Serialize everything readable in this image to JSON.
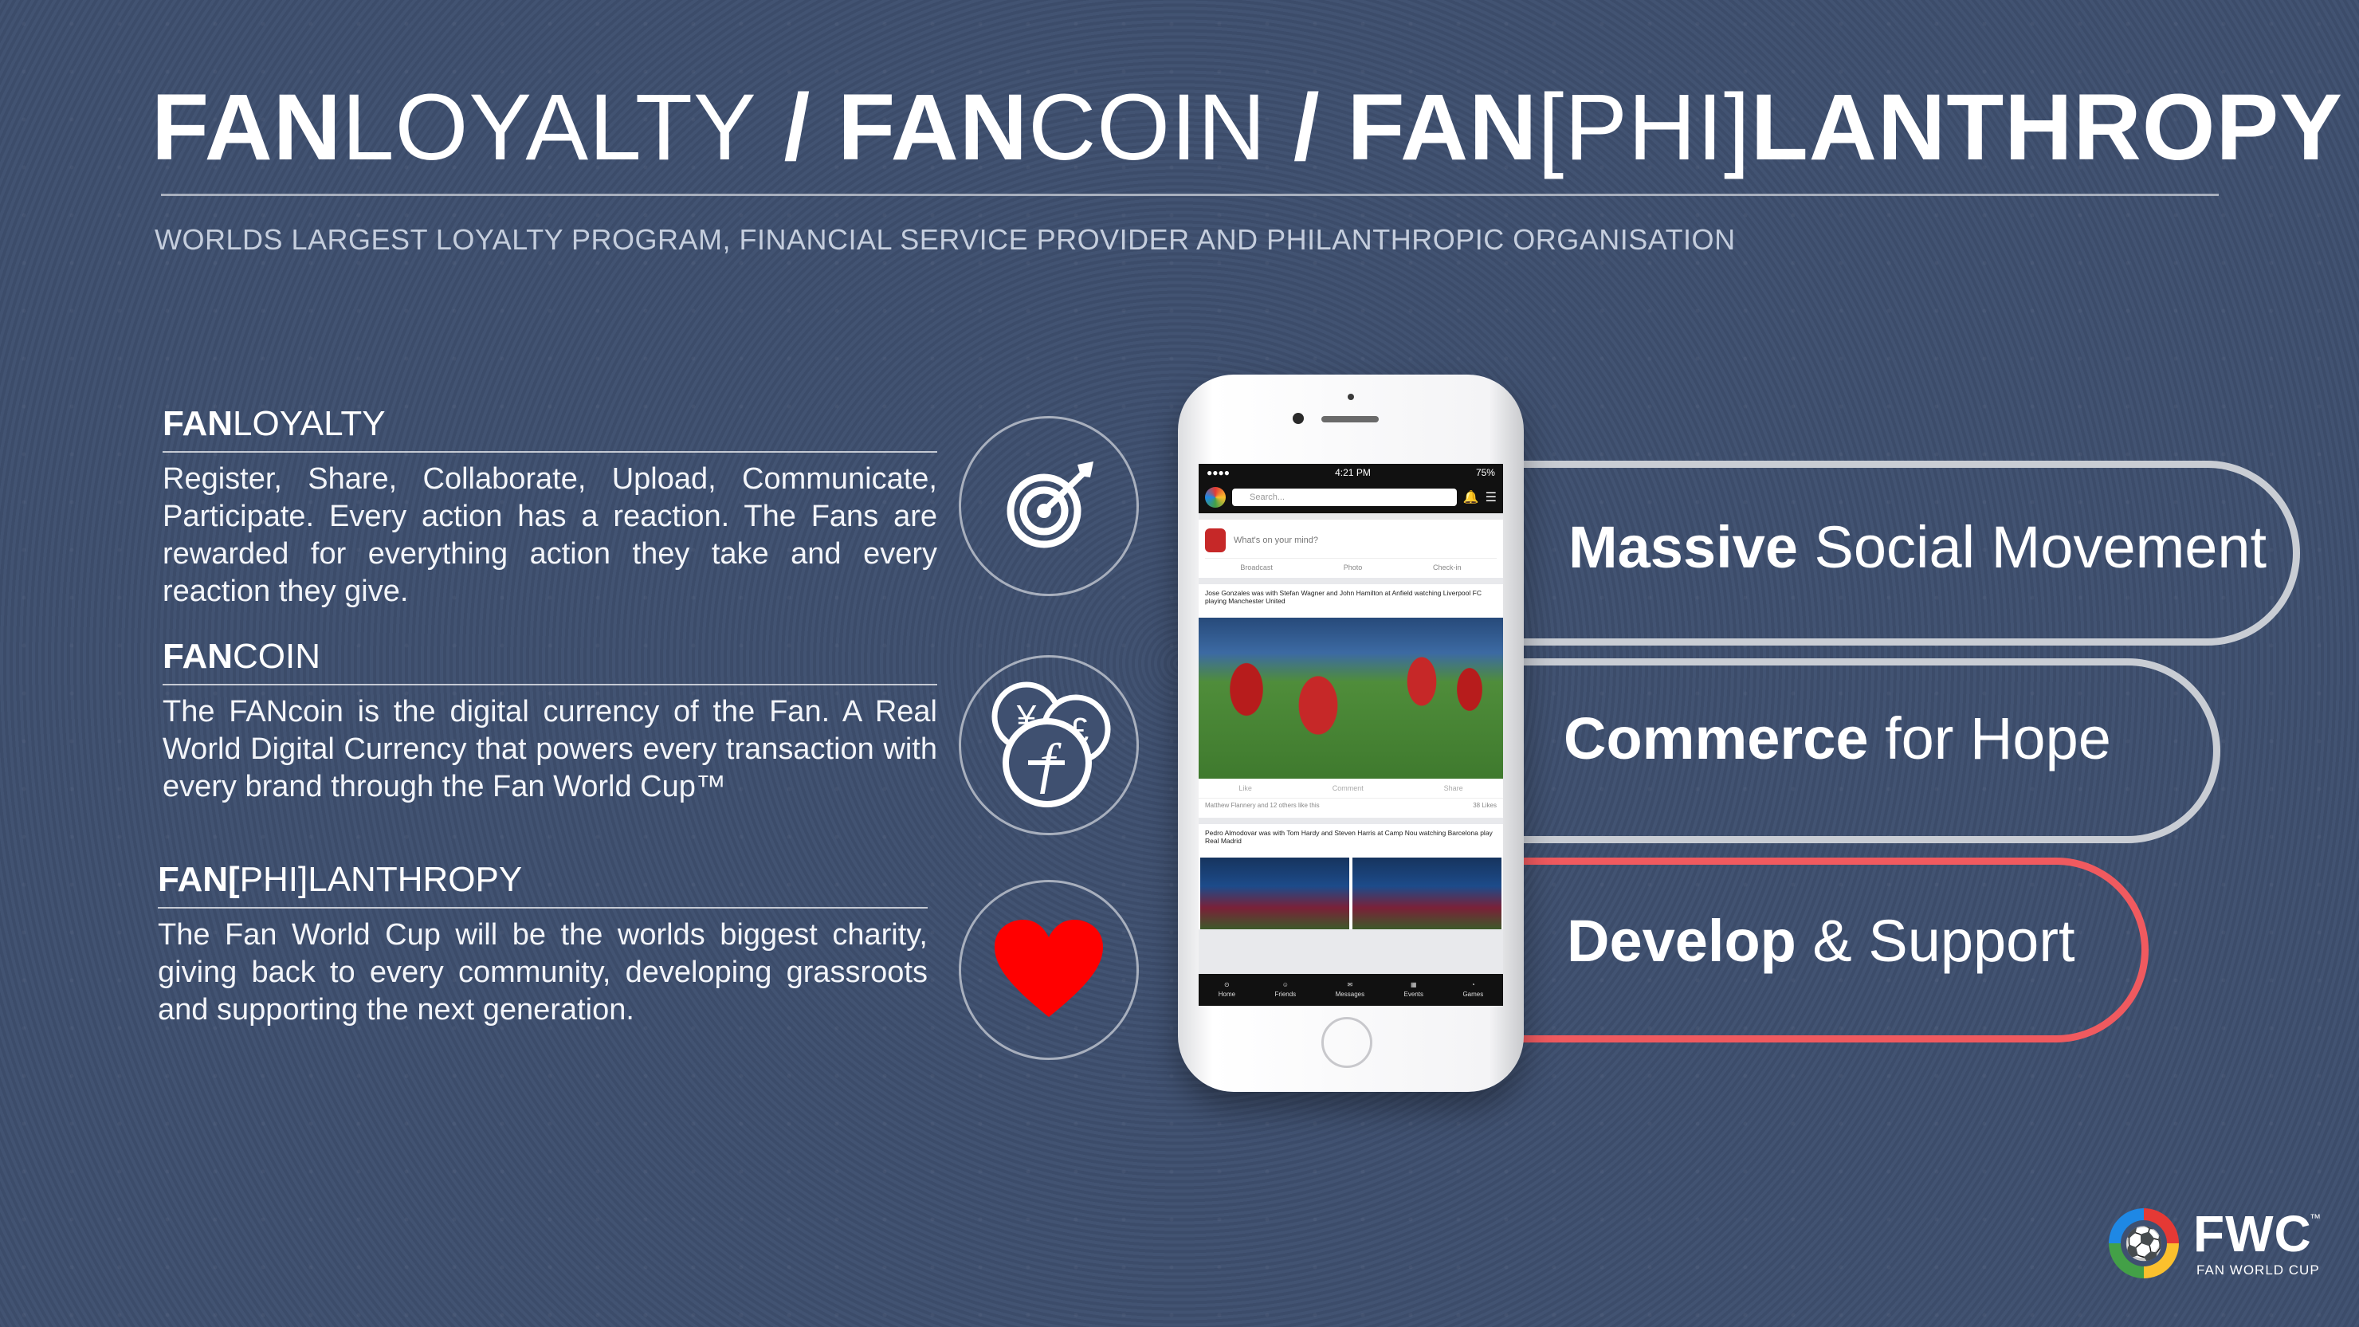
{
  "header": {
    "title_parts": [
      {
        "bold": "FAN",
        "light": "LOYALTY"
      },
      {
        "sep": " / "
      },
      {
        "bold": "FAN",
        "light": "COIN"
      },
      {
        "sep": " / "
      },
      {
        "bold": "FAN",
        "light": "[PHI]",
        "bold2": "LANTHROPY"
      }
    ],
    "subtitle": "WORLDS LARGEST LOYALTY PROGRAM, FINANCIAL SERVICE PROVIDER AND PHILANTHROPIC ORGANISATION"
  },
  "sections": [
    {
      "head_bold": "FAN",
      "head_light": "LOYALTY",
      "body": "Register, Share, Collaborate, Upload, Communicate, Participate. Every action has a reaction. The Fans are rewarded for everything action they take and every reaction they give.",
      "icon": "target-icon"
    },
    {
      "head_bold": "FAN",
      "head_light": "COIN",
      "body": "The FANcoin is the digital currency of the Fan. A Real World Digital Currency that powers every transaction with every brand through the Fan World Cup™",
      "icon": "coins-icon"
    },
    {
      "head_bold": "FAN[",
      "head_light": "PHI]LANTHROPY",
      "body": "The Fan World Cup will be the worlds biggest charity, giving back to every community, developing grassroots and supporting the next generation.",
      "icon": "heart-icon"
    }
  ],
  "pillars": [
    {
      "bold": "Massive",
      "light": " Social Movement",
      "color": "#c9cdd4"
    },
    {
      "bold": "Commerce",
      "light": " for Hope",
      "color": "#c9cdd4"
    },
    {
      "bold": "Develop",
      "light": " & Support",
      "color": "#f05a5f"
    }
  ],
  "phone": {
    "status_left": "●●●●",
    "status_time": "4:21 PM",
    "status_battery": "75%",
    "search_placeholder": "Search...",
    "compose_placeholder": "What's on your mind?",
    "compose_actions": [
      "Broadcast",
      "Photo",
      "Check-in"
    ],
    "post1_meta": "Jose Gonzales was with Stefan Wagner and John Hamilton at Anfield watching Liverpool FC playing Manchester United",
    "post_actions": [
      "Like",
      "Comment",
      "Share"
    ],
    "post1_likes": "Matthew Flannery and 12 others like this",
    "post1_likes_count": "38 Likes",
    "post2_meta": "Pedro Almodovar was with Tom Hardy and Steven Harris at Camp Nou watching Barcelona play Real Madrid",
    "tabs": [
      "Home",
      "Friends",
      "Messages",
      "Events",
      "Games"
    ]
  },
  "brand": {
    "name": "FWC",
    "tm": "™",
    "tagline": "FAN WORLD CUP"
  },
  "colors": {
    "background": "#3f5070",
    "pill_grey": "#c9cdd4",
    "pill_red": "#f05a5f",
    "heart": "#ff0000"
  }
}
